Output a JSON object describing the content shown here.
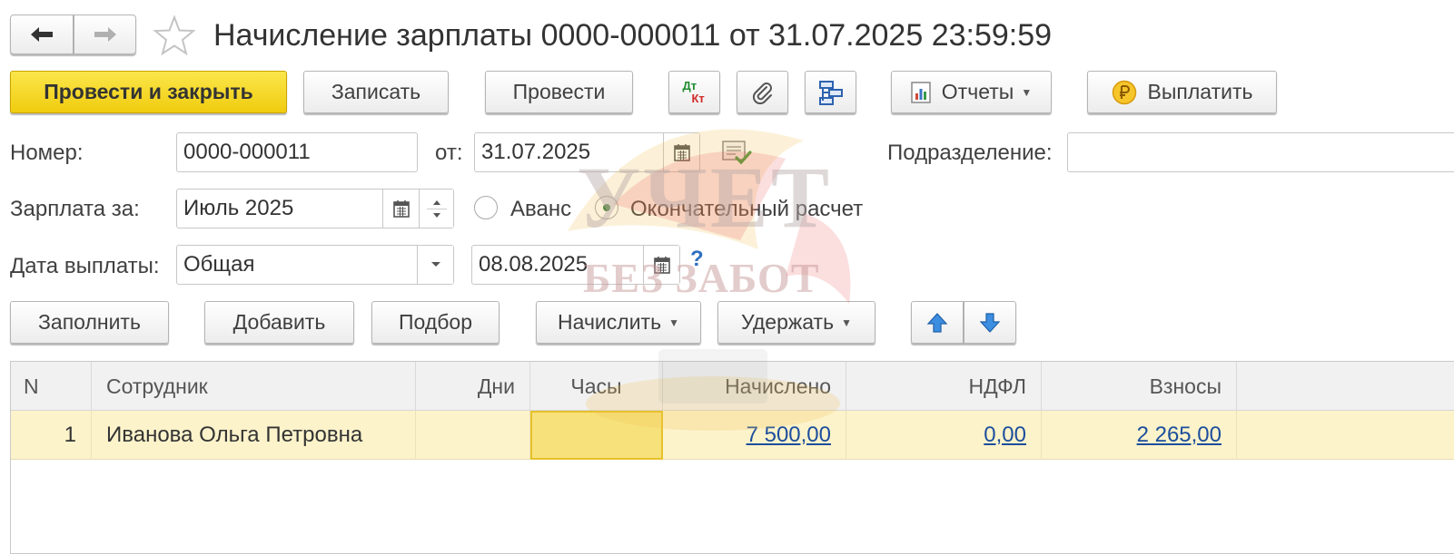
{
  "header": {
    "title": "Начисление зарплаты 0000-000011 от 31.07.2025 23:59:59"
  },
  "toolbar": {
    "post_close": "Провести и закрыть",
    "save": "Записать",
    "post": "Провести",
    "dtkt_top": "Дт",
    "dtkt_bottom": "Кт",
    "reports": "Отчеты",
    "pay": "Выплатить"
  },
  "form": {
    "number_label": "Номер:",
    "number_value": "0000-000011",
    "date_from_label": "от:",
    "date_value": "31.07.2025",
    "department_label": "Подразделение:",
    "department_value": "",
    "salary_for_label": "Зарплата за:",
    "salary_for_value": "Июль 2025",
    "advance_label": "Аванс",
    "final_label": "Окончательный расчет",
    "payment_date_label": "Дата выплаты:",
    "payment_type_value": "Общая",
    "payment_date_value": "08.08.2025",
    "help": "?"
  },
  "table_toolbar": {
    "fill": "Заполнить",
    "add": "Добавить",
    "selection": "Подбор",
    "accrue": "Начислить",
    "withhold": "Удержать"
  },
  "table": {
    "columns": [
      "N",
      "Сотрудник",
      "Дни",
      "Часы",
      "Начислено",
      "НДФЛ",
      "Взносы"
    ],
    "rows": [
      {
        "n": "1",
        "employee": "Иванова Ольга Петровна",
        "days": "",
        "hours": "",
        "accrued": "7 500,00",
        "ndfl": "0,00",
        "contributions": "2 265,00"
      }
    ]
  },
  "watermark": {
    "line1": "УЧЕТ",
    "line2": "БЕЗ ЗАБОТ"
  },
  "colors": {
    "primary": "#f5d525",
    "selected_row": "#fcf3cb",
    "link": "#1c4e9c"
  }
}
